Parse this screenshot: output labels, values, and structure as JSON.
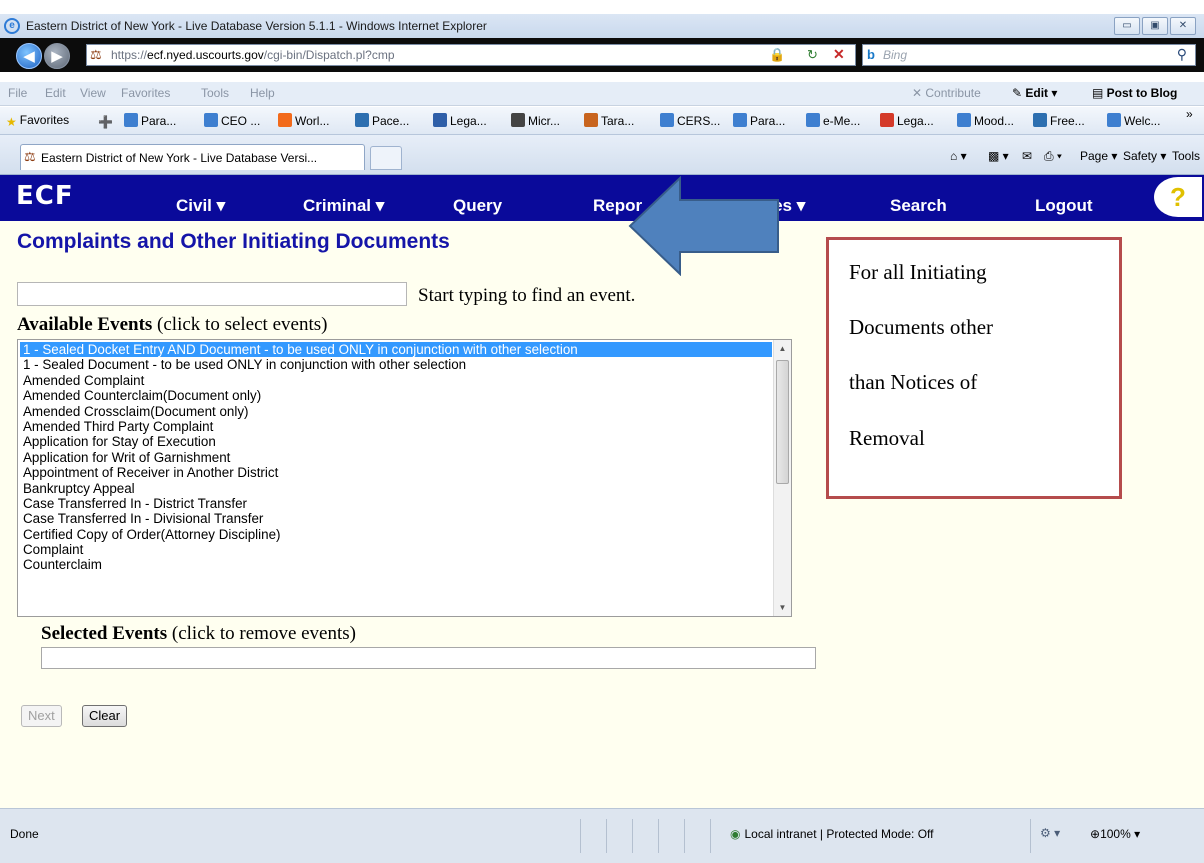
{
  "window": {
    "title": "Eastern District of New York - Live Database Version 5.1.1 - Windows Internet Explorer",
    "controls": [
      "▭",
      "▣",
      "✕"
    ]
  },
  "address": {
    "url_prefix": "https://",
    "url_domain": "ecf.nyed.uscourts.gov",
    "url_path": "/cgi-bin/Dispatch.pl?cmp",
    "search_placeholder": "Bing"
  },
  "menubar": {
    "items": [
      "File",
      "Edit",
      "View",
      "Favorites",
      "Tools",
      "Help"
    ],
    "contribute": "Contribute",
    "edit": "Edit",
    "post_to_blog": "Post to Blog"
  },
  "favorites": {
    "label": "Favorites",
    "items": [
      "Para...",
      "CEO ...",
      "Worl...",
      "Pace...",
      "Lega...",
      "Micr...",
      "Tara...",
      "CERS...",
      "Para...",
      "e-Me...",
      "Lega...",
      "Mood...",
      "Free...",
      "Welc..."
    ]
  },
  "tab": {
    "label": "Eastern District of New York - Live Database Versi..."
  },
  "commandbar": {
    "page": "Page",
    "safety": "Safety",
    "tools": "Tools"
  },
  "ecf": {
    "logo": "ECF",
    "menu": [
      "Civil",
      "Criminal",
      "Query",
      "Repor",
      "ities",
      "Search",
      "Logout"
    ]
  },
  "page": {
    "title": "Complaints and Other Initiating Documents",
    "filter_hint": "Start typing to find an event.",
    "available_bold": "Available Events",
    "available_note": "(click to select events)",
    "selected_bold": "Selected Events",
    "selected_note": "(click to remove events)",
    "events": [
      "1 - Sealed Docket Entry AND Document - to be used ONLY in conjunction with other selection",
      "1 - Sealed Document - to be used ONLY in conjunction with other selection",
      "Amended Complaint",
      "Amended Counterclaim(Document only)",
      "Amended Crossclaim(Document only)",
      "Amended Third Party Complaint",
      "Application for Stay of Execution",
      "Application for Writ of Garnishment",
      "Appointment of Receiver in Another District",
      "Bankruptcy Appeal",
      "Case Transferred In - District Transfer",
      "Case Transferred In - Divisional Transfer",
      "Certified Copy of Order(Attorney Discipline)",
      "Complaint",
      "Counterclaim"
    ],
    "selected_event_index": 0,
    "next_button": "Next",
    "clear_button": "Clear"
  },
  "callout": {
    "lines": [
      "For all Initiating",
      "Documents other",
      "than Notices of",
      "Removal"
    ],
    "border_color": "#b54c4c",
    "arrow_color": "#4f81bd"
  },
  "status": {
    "text": "Done",
    "zone": "Local intranet | Protected Mode: Off",
    "zoom": "100%"
  }
}
